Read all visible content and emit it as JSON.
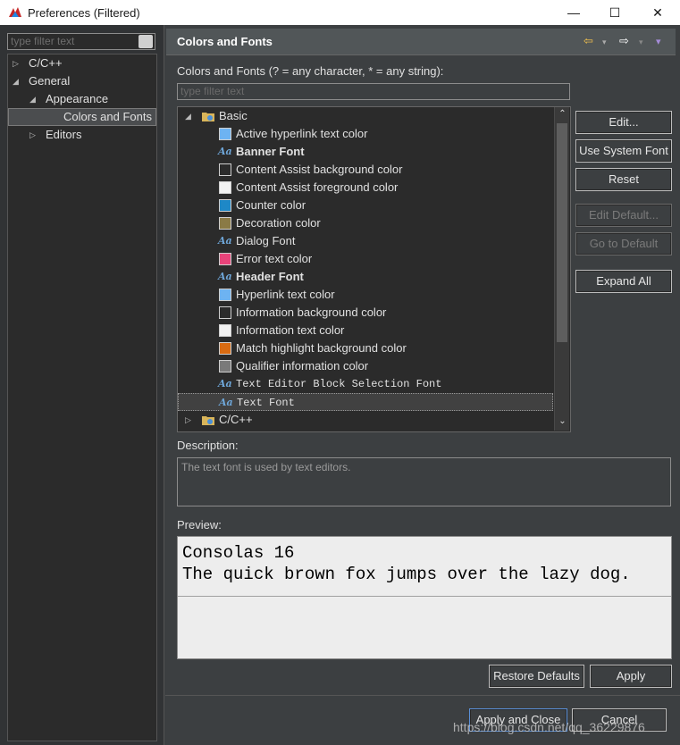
{
  "window": {
    "title": "Preferences (Filtered)",
    "minimize": "—",
    "maximize": "☐",
    "close": "✕"
  },
  "left": {
    "filter_placeholder": "type filter text",
    "tree": [
      {
        "label": "C/C++",
        "twisty": "▷"
      },
      {
        "label": "General",
        "twisty": "◢"
      },
      {
        "label": "Appearance",
        "twisty": "◢"
      },
      {
        "label": "Colors and Fonts",
        "twisty": ""
      },
      {
        "label": "Editors",
        "twisty": "▷"
      }
    ]
  },
  "page": {
    "title": "Colors and Fonts",
    "back_icon": "⇦",
    "forward_icon": "⇨",
    "menu_icon": "▾",
    "filter_label": "Colors and Fonts (? = any character, * = any string):",
    "filter_placeholder": "type filter text"
  },
  "tree": {
    "groups": [
      {
        "label": "Basic",
        "twisty": "◢"
      },
      {
        "label": "C/C++",
        "twisty": "▷"
      }
    ],
    "items": [
      {
        "label": "Active hyperlink text color",
        "kind": "color",
        "color": "#6db3f2"
      },
      {
        "label": "Banner Font",
        "kind": "font",
        "bold": true
      },
      {
        "label": "Content Assist background color",
        "kind": "color",
        "color": "#2b2b2b"
      },
      {
        "label": "Content Assist foreground color",
        "kind": "color",
        "color": "#f2f2f2"
      },
      {
        "label": "Counter color",
        "kind": "color",
        "color": "#1e88c7"
      },
      {
        "label": "Decoration color",
        "kind": "color",
        "color": "#8a7a46"
      },
      {
        "label": "Dialog Font",
        "kind": "font"
      },
      {
        "label": "Error text color",
        "kind": "color",
        "color": "#e8437a"
      },
      {
        "label": "Header Font",
        "kind": "font",
        "bold": true
      },
      {
        "label": "Hyperlink text color",
        "kind": "color",
        "color": "#6db3f2"
      },
      {
        "label": "Information background color",
        "kind": "color",
        "color": "#2b2b2b"
      },
      {
        "label": "Information text color",
        "kind": "color",
        "color": "#f2f2f2"
      },
      {
        "label": "Match highlight background color",
        "kind": "color",
        "color": "#d96b12"
      },
      {
        "label": "Qualifier information color",
        "kind": "color",
        "color": "#7a7a7a"
      },
      {
        "label": "Text Editor Block Selection Font",
        "kind": "font",
        "mono": true
      },
      {
        "label": "Text Font",
        "kind": "font",
        "mono": true,
        "selected": true
      }
    ],
    "font_icon_text": "Aa"
  },
  "buttons": {
    "edit": "Edit...",
    "use_system_font": "Use System Font",
    "reset": "Reset",
    "edit_default": "Edit Default...",
    "go_to_default": "Go to Default",
    "expand_all": "Expand All",
    "restore_defaults": "Restore Defaults",
    "apply": "Apply",
    "apply_and_close": "Apply and Close",
    "cancel": "Cancel"
  },
  "description": {
    "label": "Description:",
    "text": "The text font is used by text editors."
  },
  "preview": {
    "label": "Preview:",
    "line1": "Consolas 16",
    "line2": "The quick brown fox jumps over the lazy dog."
  },
  "watermark": "https://blog.csdn.net/qq_36229876"
}
